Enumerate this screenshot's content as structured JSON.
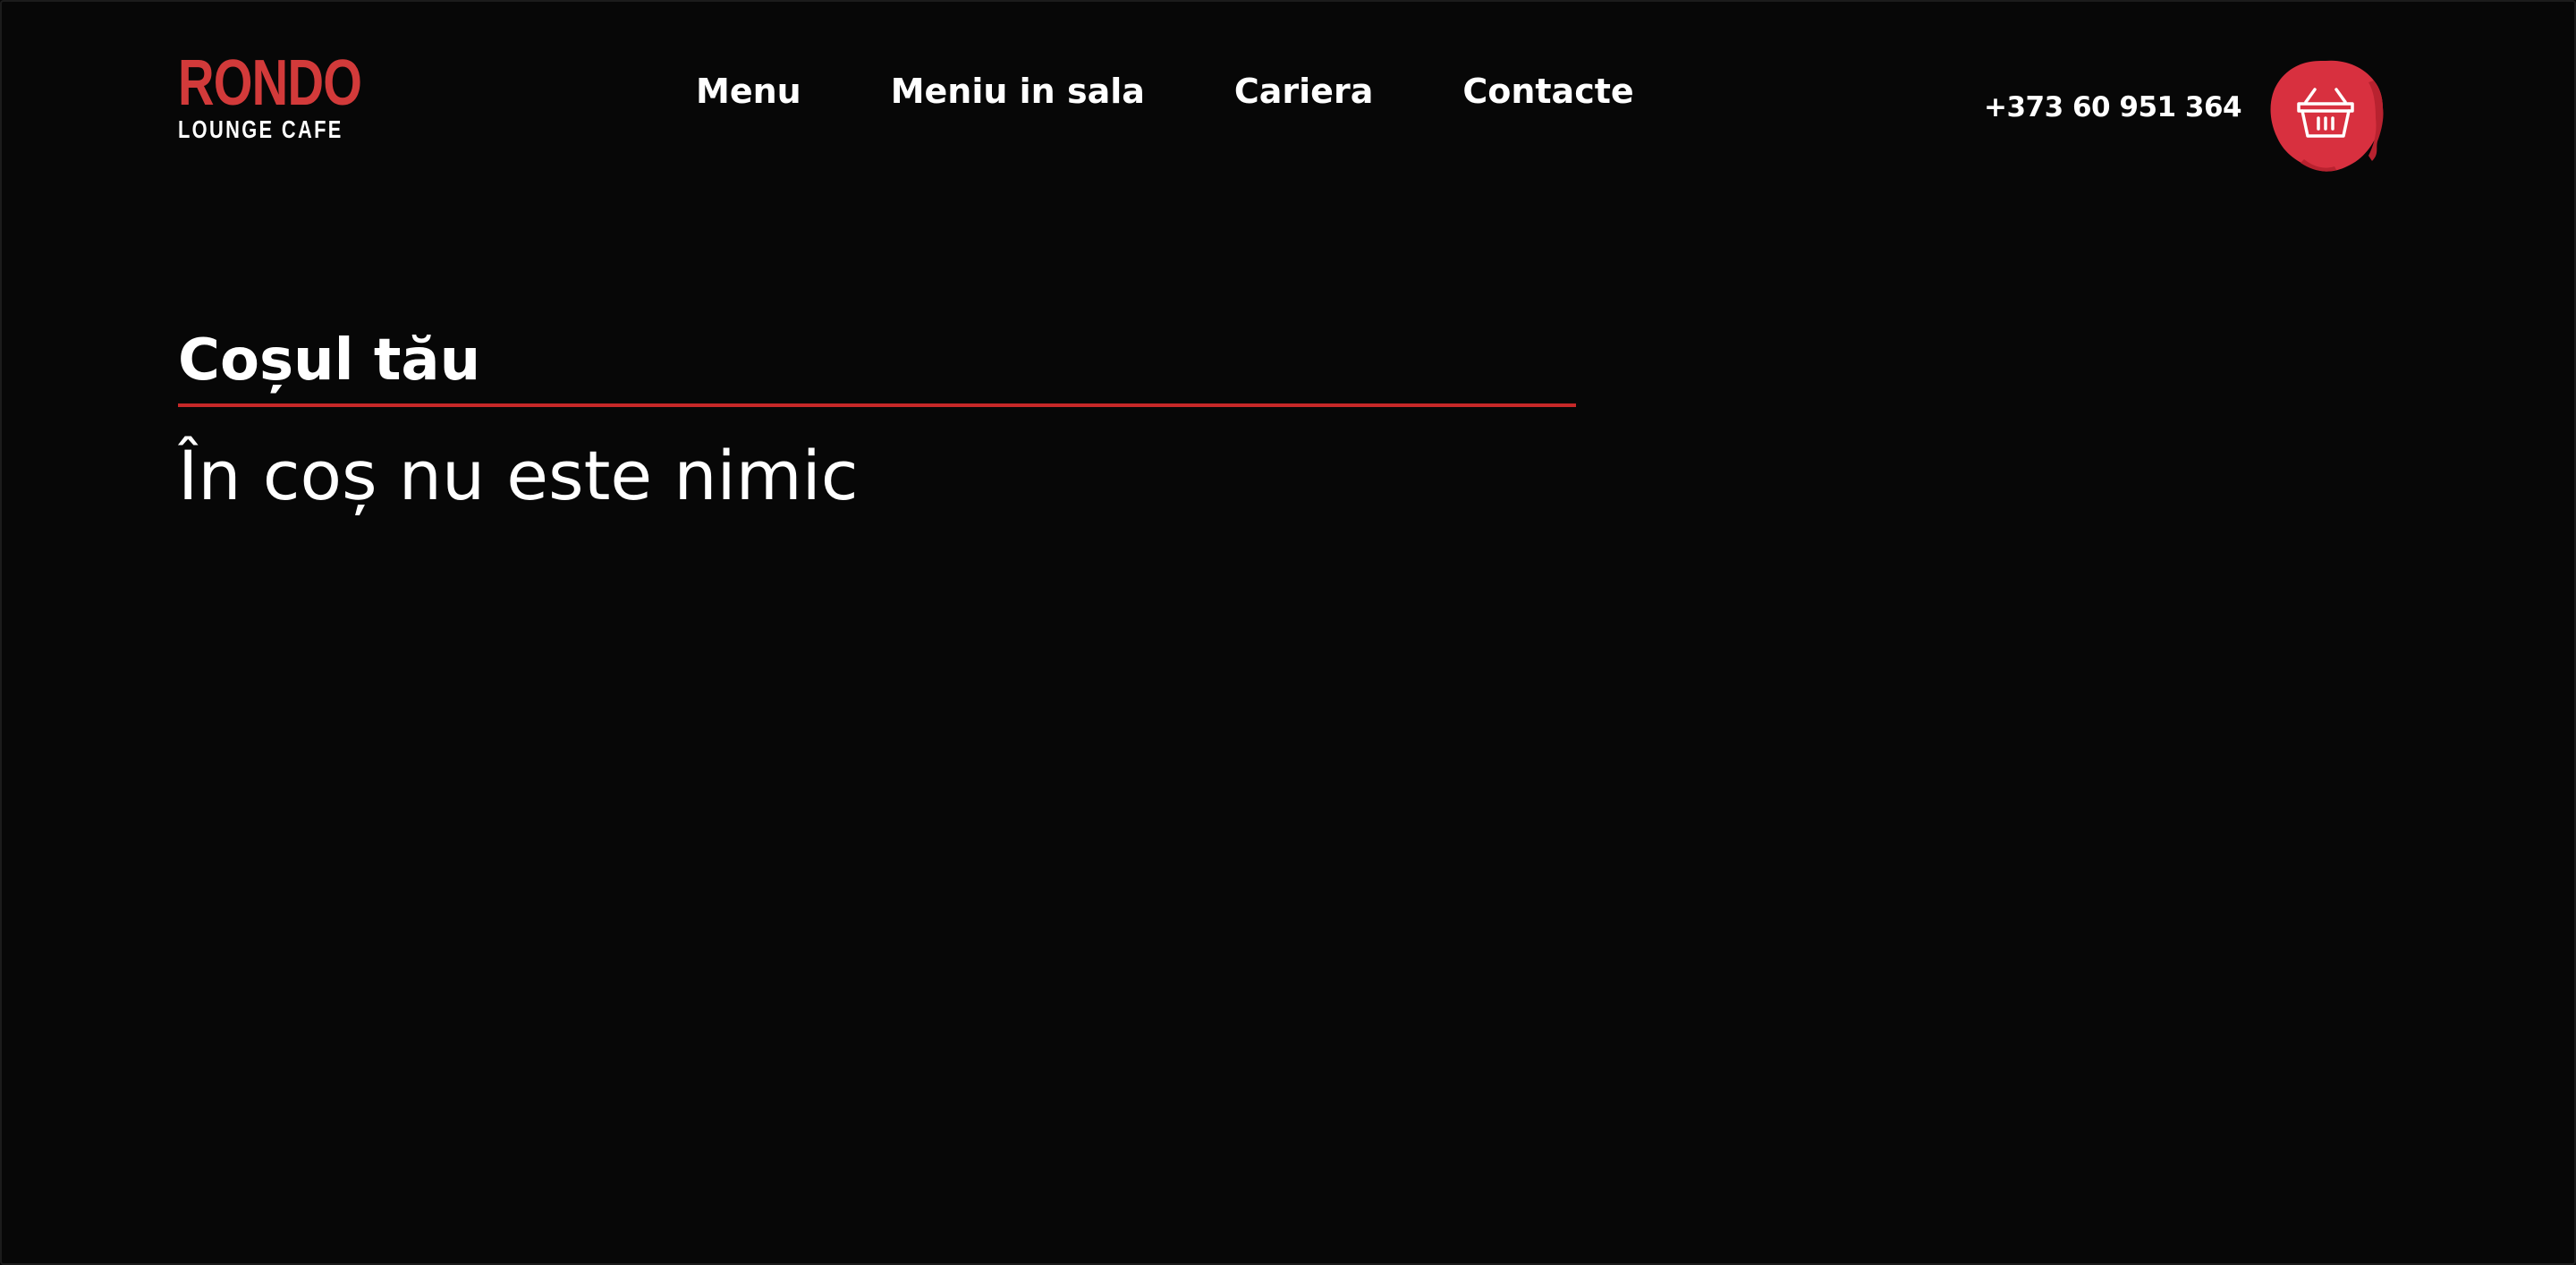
{
  "brand": {
    "name": "RONDO",
    "tagline": "LOUNGE CAFE",
    "accent_color": "#d23a3a"
  },
  "nav": {
    "items": [
      {
        "label": "Menu"
      },
      {
        "label": "Meniu in sala"
      },
      {
        "label": "Cariera"
      },
      {
        "label": "Contacte"
      }
    ]
  },
  "header": {
    "phone": "+373 60 951 364",
    "cart_icon": "basket-icon"
  },
  "cart": {
    "title": "Coșul tău",
    "empty_message": "În coș nu este nimic",
    "divider_color": "#c62828"
  },
  "theme": {
    "background": "#070707",
    "text": "#ffffff"
  }
}
